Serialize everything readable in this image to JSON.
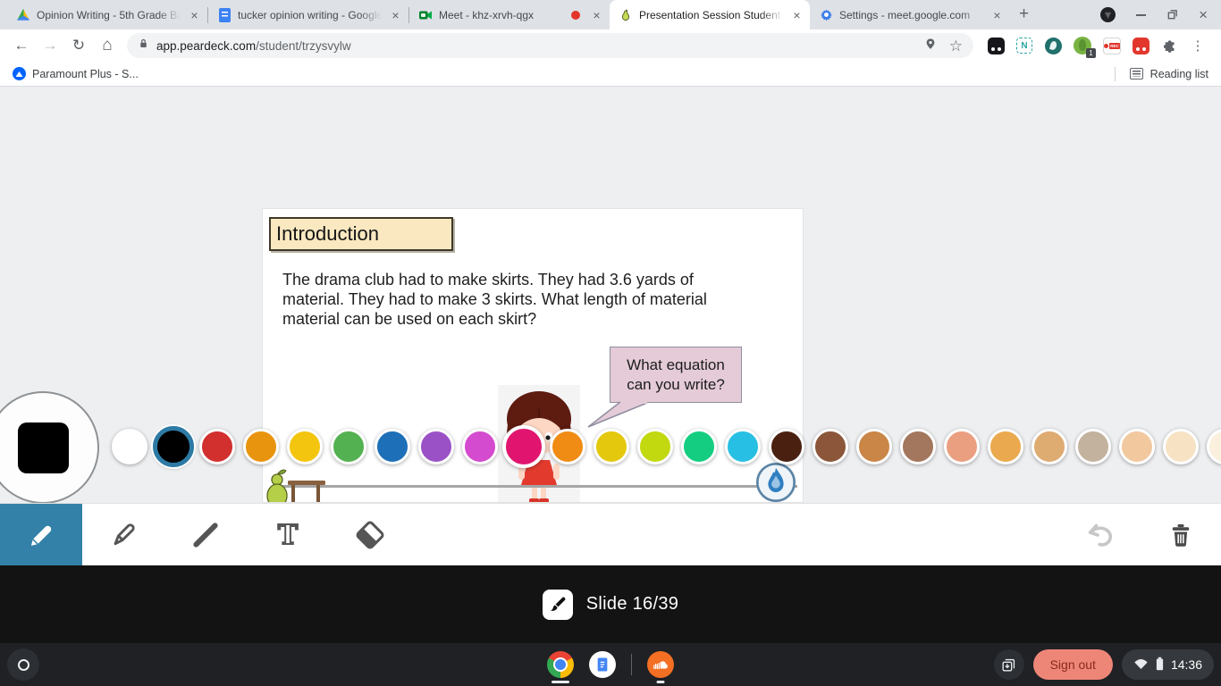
{
  "browser": {
    "tabs": [
      {
        "title": "Opinion Writing - 5th Grade Ba",
        "icon": "google-drive-icon",
        "active": false
      },
      {
        "title": "tucker opinion writing - Google",
        "icon": "google-docs-icon",
        "active": false
      },
      {
        "title": "Meet - khz-xrvh-qgx",
        "icon": "google-meet-icon",
        "active": false,
        "recording": true
      },
      {
        "title": "Presentation Session Student",
        "icon": "pear-deck-icon",
        "active": true
      },
      {
        "title": "Settings - meet.google.com",
        "icon": "settings-gear-icon",
        "active": false
      }
    ],
    "glyphs": {
      "back": "←",
      "forward": "→",
      "reload": "↻",
      "home": "⌂",
      "star": "☆",
      "menu": "⋮",
      "new_tab": "+",
      "close": "×",
      "tab_search_chevron": "▾",
      "ext_n": "N"
    },
    "omnibox": {
      "url_domain": "app.peardeck.com",
      "url_path": "/student/trzysvylw"
    },
    "extensions": {
      "peardeck_badge": "1",
      "rec_label": "REC"
    },
    "bookmarks_bar": {
      "bookmark": "Paramount Plus - S...",
      "reading_list": "Reading list"
    }
  },
  "slide": {
    "title": "Introduction",
    "body_lines": [
      "The drama club had to make skirts. They had 3.6 yards of",
      "material. They had to make 3 skirts. What length of material",
      "material can be used on each skirt?"
    ],
    "speech_bubble": [
      "What equation",
      "can you write?"
    ]
  },
  "palette": {
    "selected_index": 1,
    "enlarged_index": 9,
    "current_color": "#000000",
    "colors": [
      {
        "name": "white",
        "hex": "#ffffff"
      },
      {
        "name": "black",
        "hex": "#000000"
      },
      {
        "name": "red",
        "hex": "#d22f2f"
      },
      {
        "name": "orange",
        "hex": "#e9940f"
      },
      {
        "name": "yellow",
        "hex": "#f3c50f"
      },
      {
        "name": "green",
        "hex": "#54b151"
      },
      {
        "name": "blue",
        "hex": "#1d6fb8"
      },
      {
        "name": "purple",
        "hex": "#9b51c6"
      },
      {
        "name": "magenta",
        "hex": "#d44bd0"
      },
      {
        "name": "pink",
        "hex": "#e1156f"
      },
      {
        "name": "bright-orange",
        "hex": "#f08c14"
      },
      {
        "name": "gold",
        "hex": "#e4c80e"
      },
      {
        "name": "yellow-green",
        "hex": "#c2d80f"
      },
      {
        "name": "spring-green",
        "hex": "#14cd81"
      },
      {
        "name": "cyan",
        "hex": "#27bfe3"
      },
      {
        "name": "dark-brown",
        "hex": "#4a2111"
      },
      {
        "name": "brown",
        "hex": "#8b5639"
      },
      {
        "name": "light-brown",
        "hex": "#ca8647"
      },
      {
        "name": "taupe",
        "hex": "#a3765e"
      },
      {
        "name": "salmon",
        "hex": "#eb9f81"
      },
      {
        "name": "golden-tan",
        "hex": "#eaa94e"
      },
      {
        "name": "tan",
        "hex": "#deab71"
      },
      {
        "name": "gray-tan",
        "hex": "#c3b29e"
      },
      {
        "name": "peach",
        "hex": "#f2c89e"
      },
      {
        "name": "cream",
        "hex": "#f7e3c4"
      },
      {
        "name": "ivory",
        "hex": "#fbf0de"
      }
    ]
  },
  "footer": {
    "slide_counter": "Slide 16/39"
  },
  "shelf": {
    "sign_out_label": "Sign out",
    "time": "14:36"
  }
}
